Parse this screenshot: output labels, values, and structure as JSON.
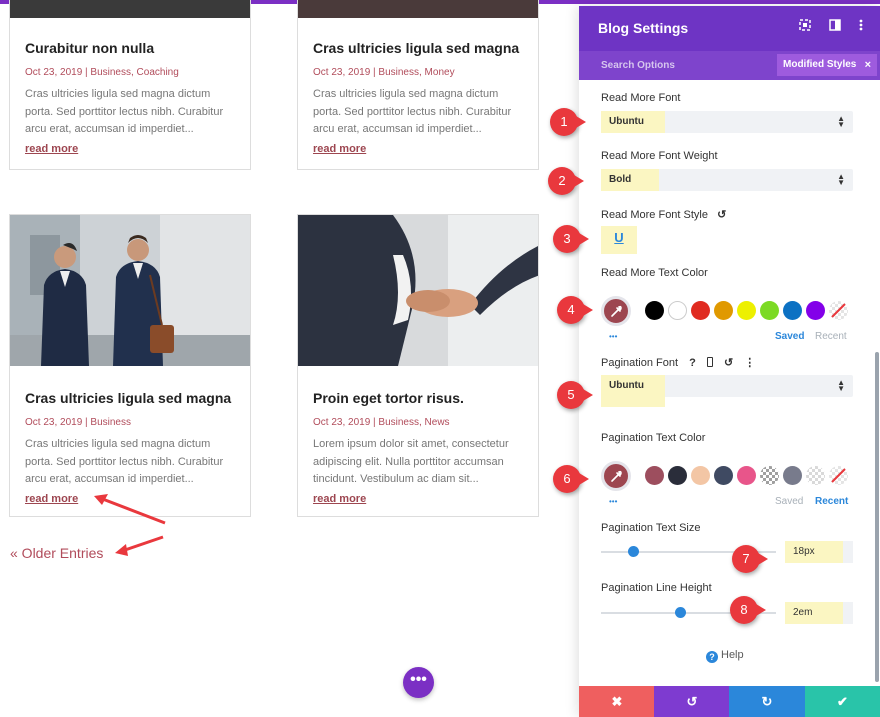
{
  "posts": [
    {
      "title": "Curabitur non nulla",
      "meta": "Oct 23, 2019 | Business, Coaching",
      "excerpt": "Cras ultricies ligula sed magna dictum porta. Sed porttitor lectus nibh. Curabitur arcu erat, accumsan id imperdiet...",
      "read_more": "read more"
    },
    {
      "title": "Cras ultricies ligula sed magna",
      "meta": "Oct 23, 2019 | Business, Money",
      "excerpt": "Cras ultricies ligula sed magna dictum porta. Sed porttitor lectus nibh. Curabitur arcu erat, accumsan id imperdiet...",
      "read_more": "read more"
    },
    {
      "title": "Cras ultricies ligula sed magna",
      "meta": "Oct 23, 2019 | Business",
      "excerpt": "Cras ultricies ligula sed magna dictum porta. Sed porttitor lectus nibh. Curabitur arcu erat, accumsan id imperdiet...",
      "read_more": "read more"
    },
    {
      "title": "Proin eget tortor risus.",
      "meta": "Oct 23, 2019 | Business, News",
      "excerpt": "Lorem ipsum dolor sit amet, consectetur adipiscing elit. Nulla porttitor accumsan tincidunt. Vestibulum ac diam sit...",
      "read_more": "read more"
    }
  ],
  "pagination": {
    "older_entries": "« Older Entries"
  },
  "fab": {
    "label": "•••"
  },
  "panel": {
    "title": "Blog Settings",
    "search_options": "Search Options",
    "modified_styles": "Modified Styles",
    "modified_close": "×",
    "read_more_font": {
      "label": "Read More Font",
      "value": "Ubuntu"
    },
    "read_more_font_weight": {
      "label": "Read More Font Weight",
      "value": "Bold"
    },
    "read_more_font_style": {
      "label": "Read More Font Style",
      "value": "U"
    },
    "read_more_text_color": {
      "label": "Read More Text Color",
      "picker_color": "#9d4650",
      "swatches": [
        "#000000",
        "#ffffff",
        "#e02b20",
        "#e09900",
        "#edf000",
        "#7cda24",
        "#0c71c3",
        "#8300e9"
      ],
      "saved": "Saved",
      "recent": "Recent",
      "dots": "•••"
    },
    "pagination_font": {
      "label": "Pagination Font",
      "value": "Ubuntu",
      "help": "?"
    },
    "pagination_text_color": {
      "label": "Pagination Text Color",
      "picker_color": "#9d4650",
      "swatches": [
        "#9d4e5e",
        "#2a2d3a",
        "#f3c6a5",
        "#3f4a62",
        "#e8558a",
        "#a0a0a0",
        "#787b8c",
        "#d9d9d9"
      ],
      "saved": "Saved",
      "recent": "Recent",
      "dots": "•••"
    },
    "pagination_text_size": {
      "label": "Pagination Text Size",
      "value": "18px",
      "slider_fraction": 0.18
    },
    "pagination_line_height": {
      "label": "Pagination Line Height",
      "value": "2em",
      "slider_fraction": 0.45
    },
    "help": "Help",
    "footer": {
      "cancel": "✖",
      "undo": "↺",
      "redo": "↻",
      "save": "✔",
      "colors": [
        "#ef5f5f",
        "#7e3bd0",
        "#2b87da",
        "#29c4a9"
      ]
    }
  },
  "callouts": [
    "1",
    "2",
    "3",
    "4",
    "5",
    "6",
    "7",
    "8"
  ],
  "colors": {
    "accent_purple": "#6e34c4",
    "link": "#9d4650",
    "highlight": "#fbf6c2"
  }
}
